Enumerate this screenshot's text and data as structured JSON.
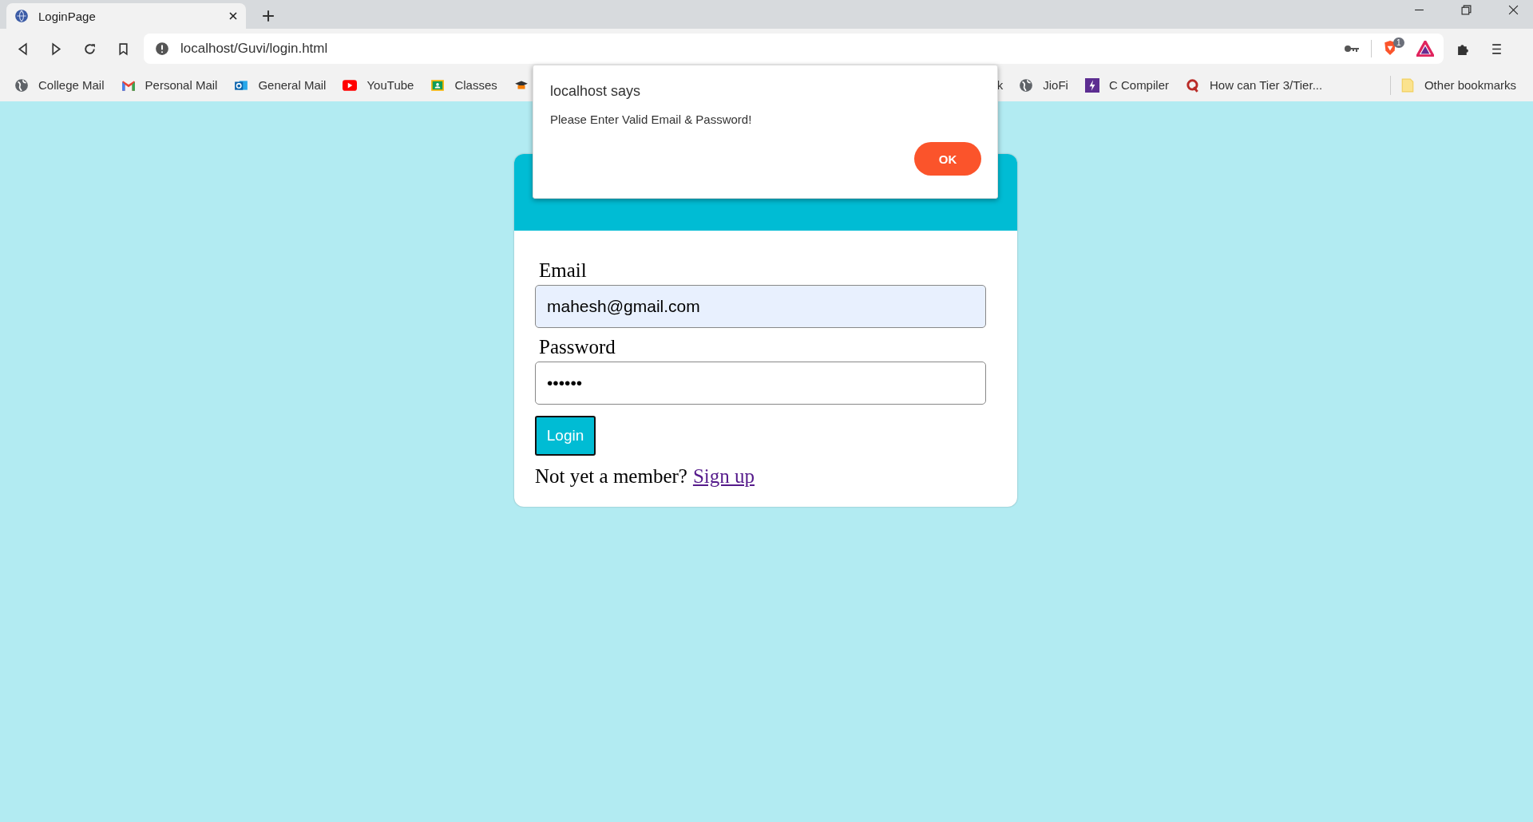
{
  "browser": {
    "tab": {
      "title": "LoginPage",
      "selected": true
    },
    "address": "localhost/Guvi/login.html",
    "extension_badge": "1",
    "bookmarks": [
      {
        "label": "College Mail",
        "kind": "globe"
      },
      {
        "label": "Personal Mail",
        "kind": "mail"
      },
      {
        "label": "General Mail",
        "kind": "outlook"
      },
      {
        "label": "YouTube",
        "kind": "video"
      },
      {
        "label": "Classes",
        "kind": "classroom"
      },
      {
        "kind": "cap"
      },
      {
        "label": "k",
        "kind": "cut"
      },
      {
        "label": "JioFi",
        "kind": "globe"
      },
      {
        "label": "C Compiler",
        "kind": "bolt"
      },
      {
        "label": "How can Tier 3/Tier...",
        "kind": "quora"
      }
    ],
    "other_bookmarks": "Other bookmarks"
  },
  "card": {
    "fields": [
      {
        "label": "Email",
        "value": "mahesh@gmail.com",
        "autofilled": true
      },
      {
        "label": "Password",
        "value": "••••••",
        "autofilled": false
      }
    ],
    "button": "Login",
    "prompt": "Not yet a member?",
    "link": "Sign up"
  },
  "dialog": {
    "title": "localhost says",
    "message": "Please Enter Valid Email & Password!",
    "button": "OK"
  }
}
